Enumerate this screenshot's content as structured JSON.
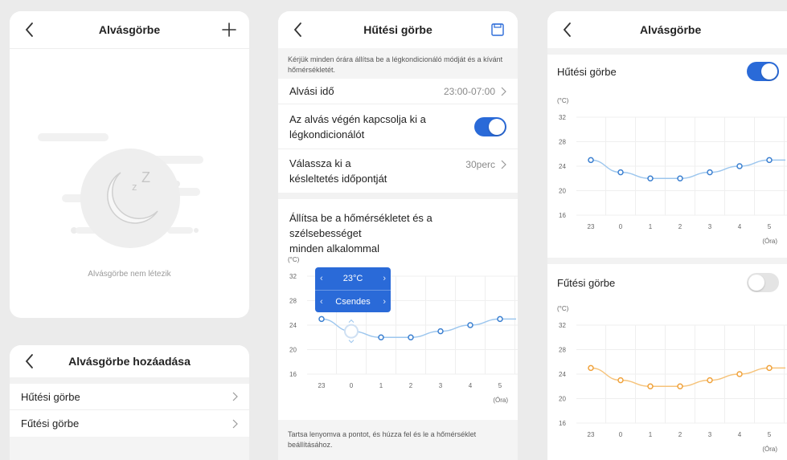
{
  "panel1": {
    "title": "Alvásgörbe",
    "empty_text": "Alvásgörbe nem létezik"
  },
  "panel1b": {
    "title": "Alvásgörbe hozáadása",
    "items": [
      {
        "label": "Hűtési görbe"
      },
      {
        "label": "Fűtési görbe"
      }
    ]
  },
  "panel2": {
    "title": "Hűtési görbe",
    "instruction": "Kérjük minden órára állítsa be a légkondicionáló módját és a kívánt hőmérsékletét.",
    "sleep_time_label": "Alvási idő",
    "sleep_time_value": "23:00-07:00",
    "turn_off_label_1": "Az alvás végén kapcsolja ki a",
    "turn_off_label_2": "légkondicionálót",
    "turn_off_enabled": true,
    "delay_label_1": "Válassza ki a",
    "delay_label_2": "késleltetés időpontját",
    "delay_value": "30perc",
    "chart_heading_1": "Állítsa be a hőmérsékletet és a szélsebességet",
    "chart_heading_2": "minden alkalommal",
    "popup_temp": "23°C",
    "popup_fan": "Csendes",
    "footer_note": "Tartsa lenyomva a pontot, és húzza fel és le a hőmérséklet beállításához."
  },
  "panel3": {
    "title": "Alvásgörbe",
    "cooling_label": "Hűtési görbe",
    "cooling_enabled": true,
    "heating_label": "Fűtési görbe",
    "heating_enabled": false
  },
  "colors": {
    "accent": "#2a6ad8",
    "cool_line": "#9cc6ee",
    "cool_point": "#3a7fd0",
    "heat_line": "#f6c37a",
    "heat_point": "#f0a23b"
  },
  "chart_data": [
    {
      "id": "setup-chart",
      "type": "line",
      "unit_label": "(°C)",
      "x_label": "(Óra)",
      "categories": [
        "23",
        "0",
        "1",
        "2",
        "3",
        "4",
        "5"
      ],
      "values": [
        25,
        23,
        22,
        22,
        23,
        24,
        25
      ],
      "yticks": [
        32,
        28,
        24,
        20,
        16
      ],
      "ylim": [
        16,
        32
      ],
      "selected_index": 1
    },
    {
      "id": "cooling-chart",
      "type": "line",
      "unit_label": "(°C)",
      "x_label": "(Óra)",
      "categories": [
        "23",
        "0",
        "1",
        "2",
        "3",
        "4",
        "5"
      ],
      "values": [
        25,
        23,
        22,
        22,
        23,
        24,
        25
      ],
      "yticks": [
        32,
        28,
        24,
        20,
        16
      ],
      "ylim": [
        16,
        32
      ]
    },
    {
      "id": "heating-chart",
      "type": "line",
      "unit_label": "(°C)",
      "x_label": "(Óra)",
      "categories": [
        "23",
        "0",
        "1",
        "2",
        "3",
        "4",
        "5"
      ],
      "values": [
        25,
        23,
        22,
        22,
        23,
        24,
        25
      ],
      "yticks": [
        32,
        28,
        24,
        20,
        16
      ],
      "ylim": [
        16,
        32
      ]
    }
  ]
}
